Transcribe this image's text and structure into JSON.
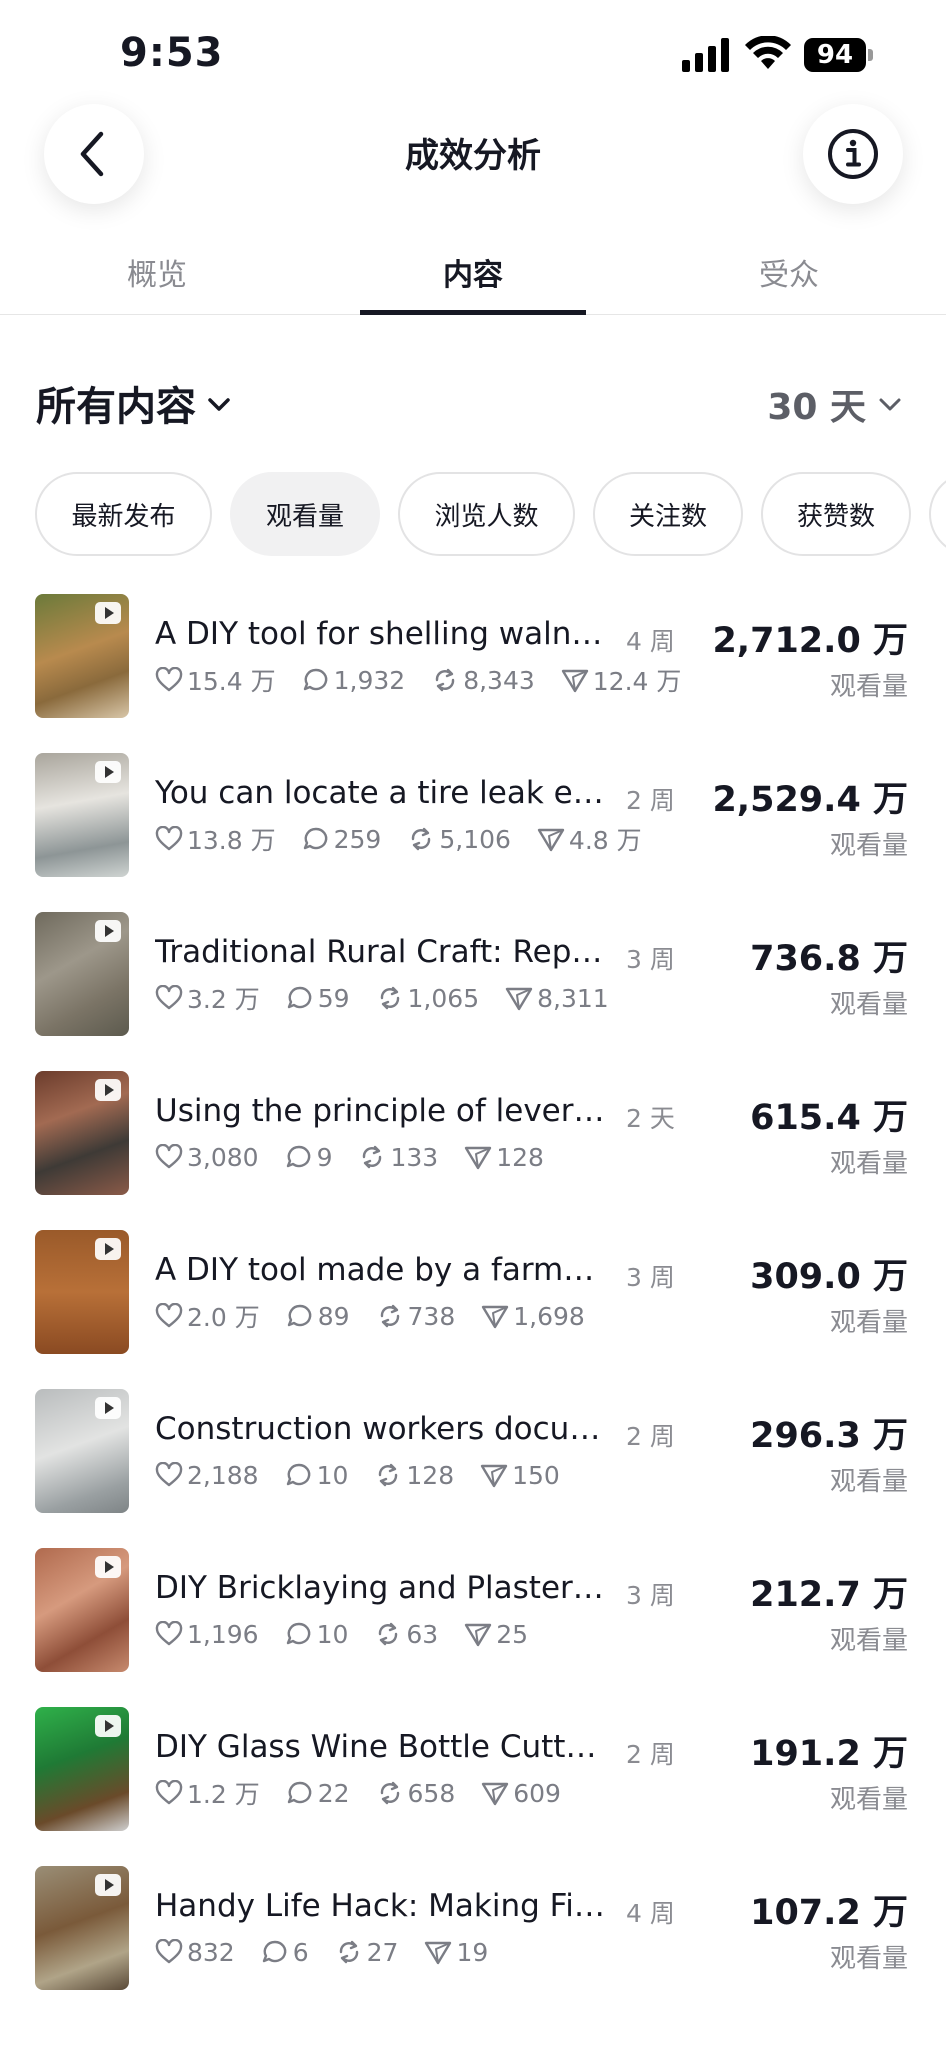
{
  "status_bar": {
    "time": "9:53",
    "battery": "94"
  },
  "header": {
    "title": "成效分析"
  },
  "tabs": [
    {
      "label": "概览"
    },
    {
      "label": "内容"
    },
    {
      "label": "受众"
    }
  ],
  "filter": {
    "title": "所有内容",
    "range": "30 天"
  },
  "chips": [
    {
      "label": "最新发布"
    },
    {
      "label": "观看量"
    },
    {
      "label": "浏览人数"
    },
    {
      "label": "关注数"
    },
    {
      "label": "获赞数"
    }
  ],
  "views_label": "观看量",
  "videos": [
    {
      "title": "A DIY tool for shelling walnuts...",
      "age": "4 周",
      "likes": "15.4 万",
      "comments": "1,932",
      "shares": "8,343",
      "saves": "12.4 万",
      "views": "2,712.0 万"
    },
    {
      "title": "You can locate a tire leak even...",
      "age": "2 周",
      "likes": "13.8 万",
      "comments": "259",
      "shares": "5,106",
      "saves": "4.8 万",
      "views": "2,529.4 万"
    },
    {
      "title": "Traditional Rural Craft: Repairi...",
      "age": "3 周",
      "likes": "3.2 万",
      "comments": "59",
      "shares": "1,065",
      "saves": "8,311",
      "views": "736.8 万"
    },
    {
      "title": "Using the principle of leverage...",
      "age": "2 天",
      "likes": "3,080",
      "comments": "9",
      "shares": "133",
      "saves": "128",
      "views": "615.4 万"
    },
    {
      "title": "A DIY tool made by a farmer—...",
      "age": "3 周",
      "likes": "2.0 万",
      "comments": "89",
      "shares": "738",
      "saves": "1,698",
      "views": "309.0 万"
    },
    {
      "title": "Construction workers docume...",
      "age": "2 周",
      "likes": "2,188",
      "comments": "10",
      "shares": "128",
      "saves": "150",
      "views": "296.3 万"
    },
    {
      "title": "DIY Bricklaying and Plastering...",
      "age": "3 周",
      "likes": "1,196",
      "comments": "10",
      "shares": "63",
      "saves": "25",
      "views": "212.7 万"
    },
    {
      "title": "DIY Glass Wine Bottle Cutter...",
      "age": "2 周",
      "likes": "1.2 万",
      "comments": "22",
      "shares": "658",
      "saves": "609",
      "views": "191.2 万"
    },
    {
      "title": "Handy Life Hack: Making Fing...",
      "age": "4 周",
      "likes": "832",
      "comments": "6",
      "shares": "27",
      "saves": "19",
      "views": "107.2 万"
    }
  ]
}
